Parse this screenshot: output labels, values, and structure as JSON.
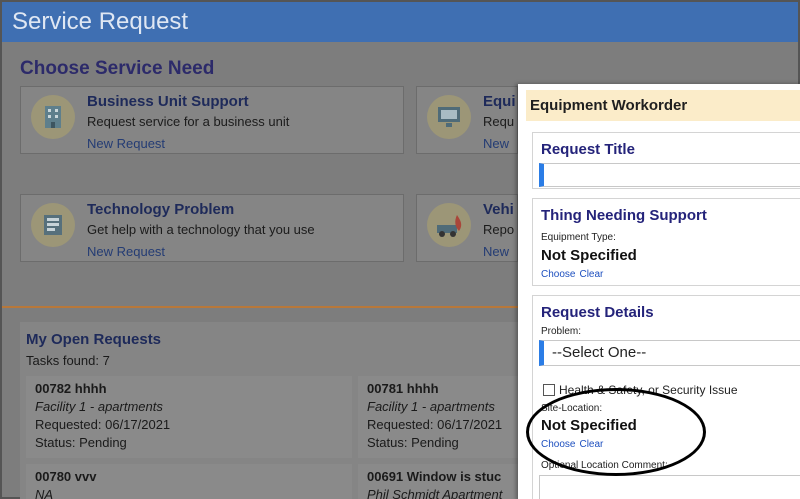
{
  "app": {
    "title": "Service Request"
  },
  "choose": {
    "title": "Choose Service Need",
    "cards": [
      {
        "title": "Business Unit Support",
        "desc": "Request service for a business unit",
        "link": "New Request"
      },
      {
        "title": "Equi",
        "desc": "Requ",
        "link": "New"
      },
      {
        "title": "Technology Problem",
        "desc": "Get help with a technology that you use",
        "link": "New Request"
      },
      {
        "title": "Vehi",
        "desc": "Repo",
        "link": "New"
      }
    ]
  },
  "requests": {
    "title": "My Open Requests",
    "tasks_found": "Tasks found: 7",
    "items": [
      {
        "id": "00782  hhhh",
        "location": "Facility 1 - apartments",
        "requested": "Requested: 06/17/2021",
        "status": "Status: Pending"
      },
      {
        "id": "00781  hhhh",
        "location": "Facility 1 - apartments",
        "requested": "Requested: 06/17/2021",
        "status": "Status: Pending"
      },
      {
        "id": "00780  vvv",
        "location": "NA"
      },
      {
        "id": "00691  Window is stuc",
        "location": "Phil Schmidt Apartment"
      }
    ]
  },
  "modal": {
    "title": "Equipment Workorder",
    "request_title": {
      "label": "Request Title",
      "value": ""
    },
    "thing": {
      "label": "Thing Needing Support",
      "equipment_type_label": "Equipment Type:",
      "equipment_type_value": "Not Specified",
      "choose": "Choose",
      "clear": "Clear"
    },
    "details": {
      "label": "Request Details",
      "problem_label": "Problem:",
      "problem_value": "--Select One--",
      "checkbox_label": "Health & Safety, or Security Issue",
      "site_location_label": "Site-Location:",
      "site_location_value": "Not Specified",
      "choose": "Choose",
      "clear": "Clear",
      "optional_comment_label": "Optional Location Comment:"
    }
  },
  "colors": {
    "header": "#3f6fb2",
    "accent": "#2b7de6",
    "modal_header": "#fbecc9"
  }
}
